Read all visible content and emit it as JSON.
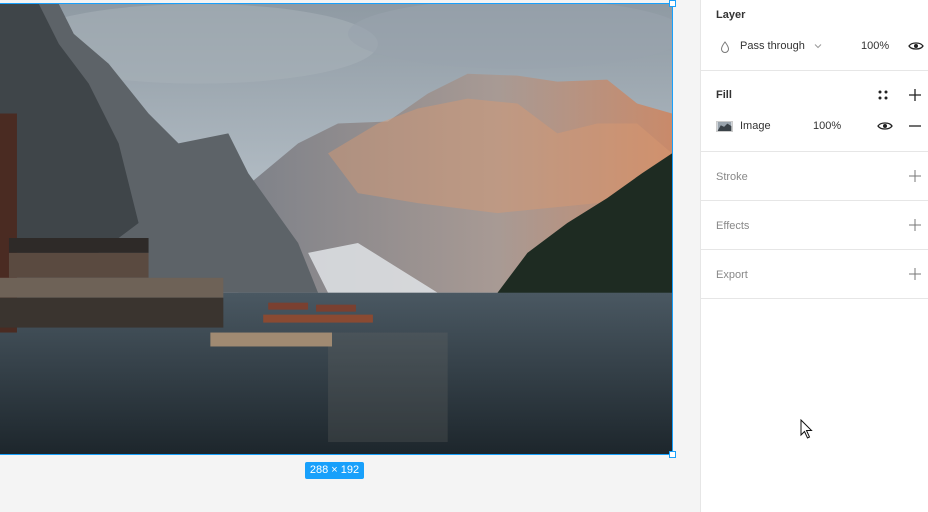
{
  "canvas": {
    "size_label": "288 × 192"
  },
  "panel": {
    "layer": {
      "title": "Layer",
      "blend_mode": "Pass through",
      "opacity": "100%"
    },
    "fill": {
      "title": "Fill",
      "type_label": "Image",
      "opacity": "100%"
    },
    "stroke": {
      "title": "Stroke"
    },
    "effects": {
      "title": "Effects"
    },
    "export": {
      "title": "Export"
    }
  },
  "colors": {
    "selection": "#18a0fb",
    "panel_bg": "#ffffff",
    "canvas_bg": "#f4f4f4"
  },
  "icons": [
    "blend-drop-icon",
    "chevron-down-icon",
    "eye-icon",
    "styles-grid-icon",
    "plus-icon",
    "minus-icon",
    "image-swatch-icon",
    "mouse-cursor-icon"
  ]
}
